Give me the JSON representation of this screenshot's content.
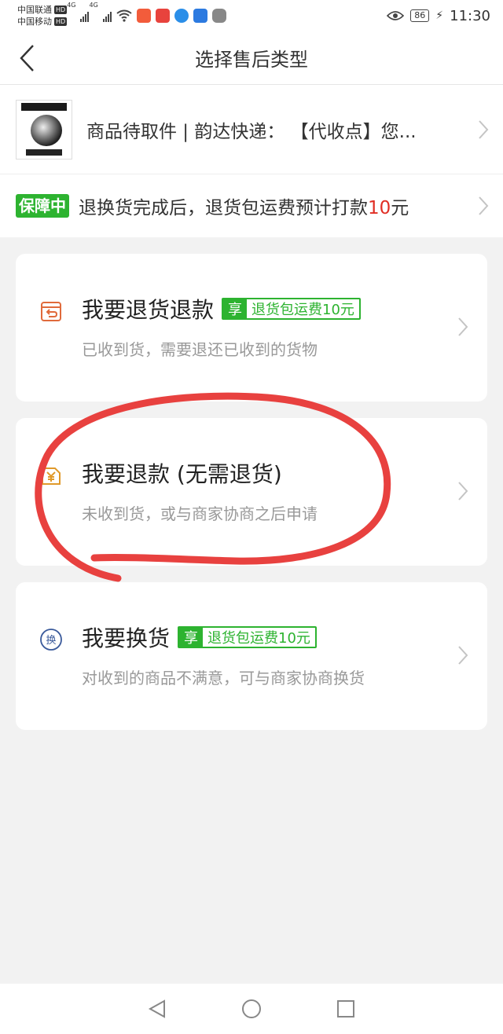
{
  "status_bar": {
    "carrier1": "中国联通",
    "carrier2": "中国移动",
    "hd": "HD",
    "network": "4G",
    "battery": "86",
    "time": "11:30"
  },
  "nav": {
    "title": "选择售后类型"
  },
  "product": {
    "status_text": "商品待取件 | 韵达快递：  【代收点】您..."
  },
  "guarantee": {
    "badge": "保障中",
    "text_before": "退换货完成后，退货包运费预计打款",
    "amount": "10",
    "text_after": "元"
  },
  "options": [
    {
      "title": "我要退货退款",
      "perk_tag": "享",
      "perk_text": "退货包运费10元",
      "desc": "已收到货，需要退还已收到的货物",
      "icon": "return-box-icon"
    },
    {
      "title": "我要退款 (无需退货)",
      "perk_tag": "",
      "perk_text": "",
      "desc": "未收到货，或与商家协商之后申请",
      "icon": "refund-yuan-icon"
    },
    {
      "title": "我要换货",
      "perk_tag": "享",
      "perk_text": "退货包运费10元",
      "desc": "对收到的商品不满意，可与商家协商换货",
      "icon": "exchange-icon",
      "icon_glyph": "换"
    }
  ],
  "colors": {
    "accent_green": "#2db330",
    "amount_red": "#e02e24",
    "annotation_red": "#e8413f",
    "icon_orange": "#e06a3b",
    "icon_blue": "#3a5a9b"
  }
}
